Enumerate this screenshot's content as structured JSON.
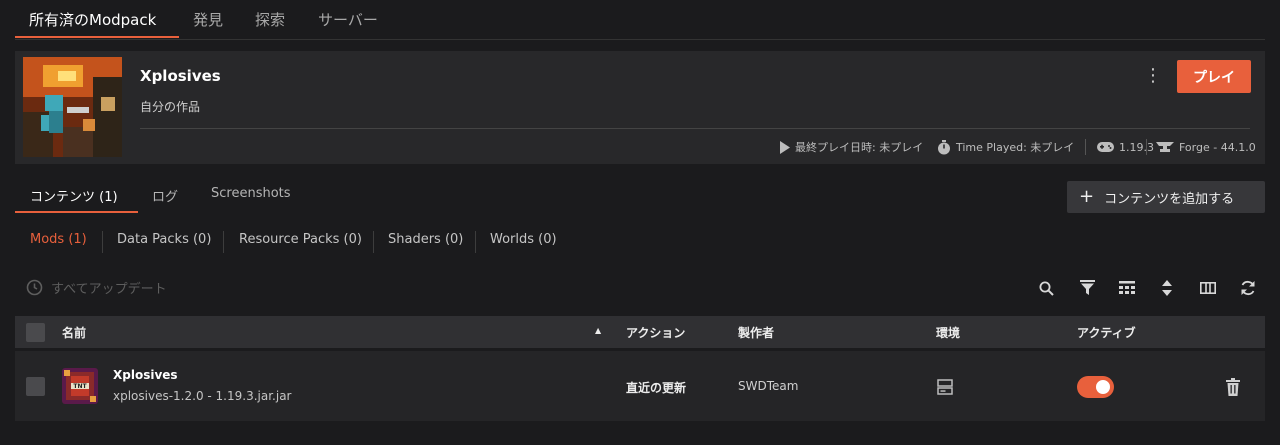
{
  "top_tabs": [
    "所有済のModpack",
    "発見",
    "探索",
    "サーバー"
  ],
  "modpack": {
    "title": "Xplosives",
    "subtitle": "自分の作品",
    "play_label": "プレイ",
    "last_played": "最終プレイ日時: 未プレイ",
    "time_played": "Time Played: 未プレイ",
    "version": "1.19.3",
    "loader": "Forge - 44.1.0"
  },
  "content_tabs": [
    "コンテンツ (1)",
    "ログ",
    "Screenshots"
  ],
  "add_content_label": "コンテンツを追加する",
  "filters": [
    "Mods (1)",
    "Data Packs (0)",
    "Resource Packs (0)",
    "Shaders (0)",
    "Worlds (0)"
  ],
  "update_all_label": "すべてアップデート",
  "table": {
    "columns": [
      "名前",
      "アクション",
      "製作者",
      "環境",
      "アクティブ"
    ],
    "sort_indicator": "▲",
    "rows": [
      {
        "name": "Xplosives",
        "file": "xplosives-1.2.0 - 1.19.3.jar.jar",
        "action": "直近の更新",
        "author": "SWDTeam",
        "icon_text": "TNT",
        "active": true
      }
    ]
  },
  "colors": {
    "accent": "#e8603c",
    "background": "#1b1b1d",
    "card": "#28282a"
  }
}
